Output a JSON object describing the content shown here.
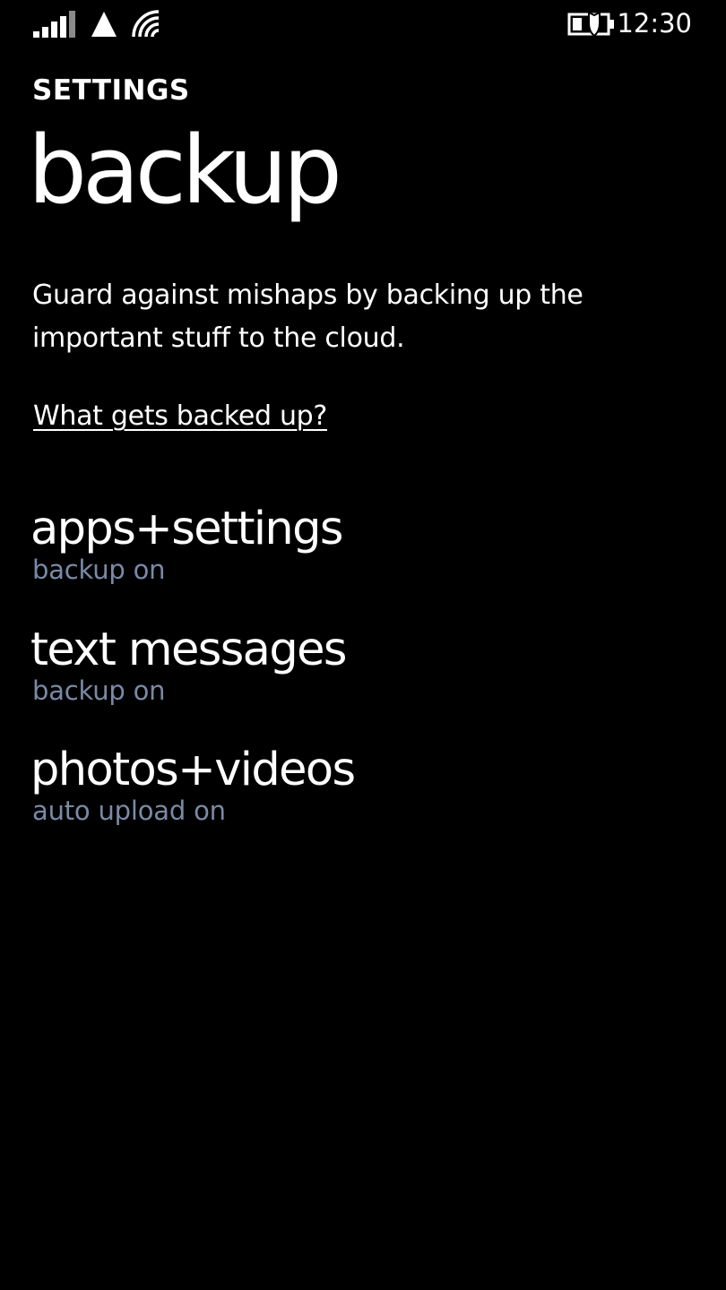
{
  "colors": {
    "background": "#000000",
    "text": "#ffffff",
    "subtle_text": "#7a8aa6"
  },
  "status_bar": {
    "time": "12:30",
    "icons": [
      "signal-strength-icon",
      "mobile-data-icon",
      "wifi-icon",
      "battery-saver-icon"
    ]
  },
  "header": {
    "app_title": "SETTINGS",
    "page_title": "backup"
  },
  "description": "Guard against mishaps by backing up the important stuff to the cloud.",
  "info_link": "What gets backed up?",
  "items": [
    {
      "title": "apps+settings",
      "subtitle": "backup on"
    },
    {
      "title": "text messages",
      "subtitle": "backup on"
    },
    {
      "title": "photos+videos",
      "subtitle": "auto upload on"
    }
  ]
}
